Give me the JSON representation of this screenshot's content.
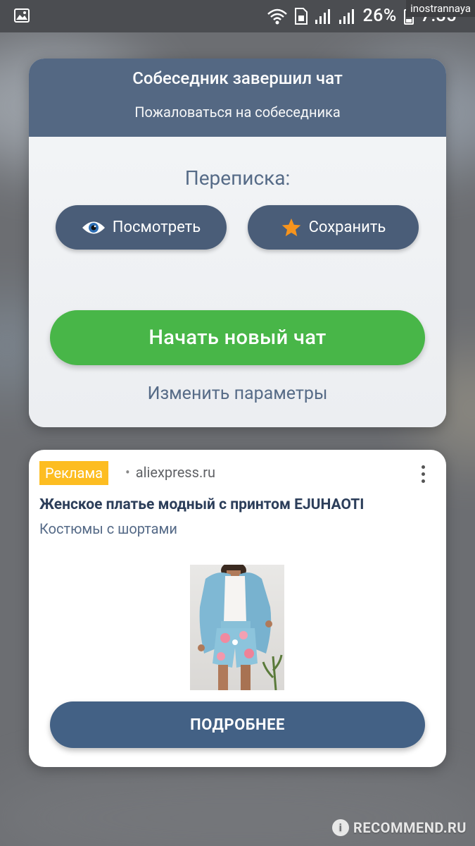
{
  "status_bar": {
    "battery": "26%",
    "time": "7:35",
    "watermark_user": "inostrannaya"
  },
  "chat_end": {
    "title": "Собеседник завершил чат",
    "report_link": "Пожаловаться на собеседника",
    "chat_label": "Переписка:",
    "view_button": "Посмотреть",
    "save_button": "Сохранить",
    "start_new_chat_button": "Начать новый чат",
    "change_params_link": "Изменить параметры"
  },
  "ad": {
    "badge": "Реклама",
    "domain": "aliexpress.ru",
    "title": "Женское платье модный с принтом EJUHAOTI",
    "subtitle": "Костюмы с шортами",
    "cta_button": "ПОДРОБНЕЕ"
  },
  "watermark": {
    "text": "RECOMMEND.RU"
  },
  "colors": {
    "header_blue": "#546883",
    "pill_blue": "#4a5d78",
    "green": "#48b648",
    "ad_badge": "#fdbd21",
    "cta_blue": "#436185",
    "star_orange": "#f7941d"
  }
}
